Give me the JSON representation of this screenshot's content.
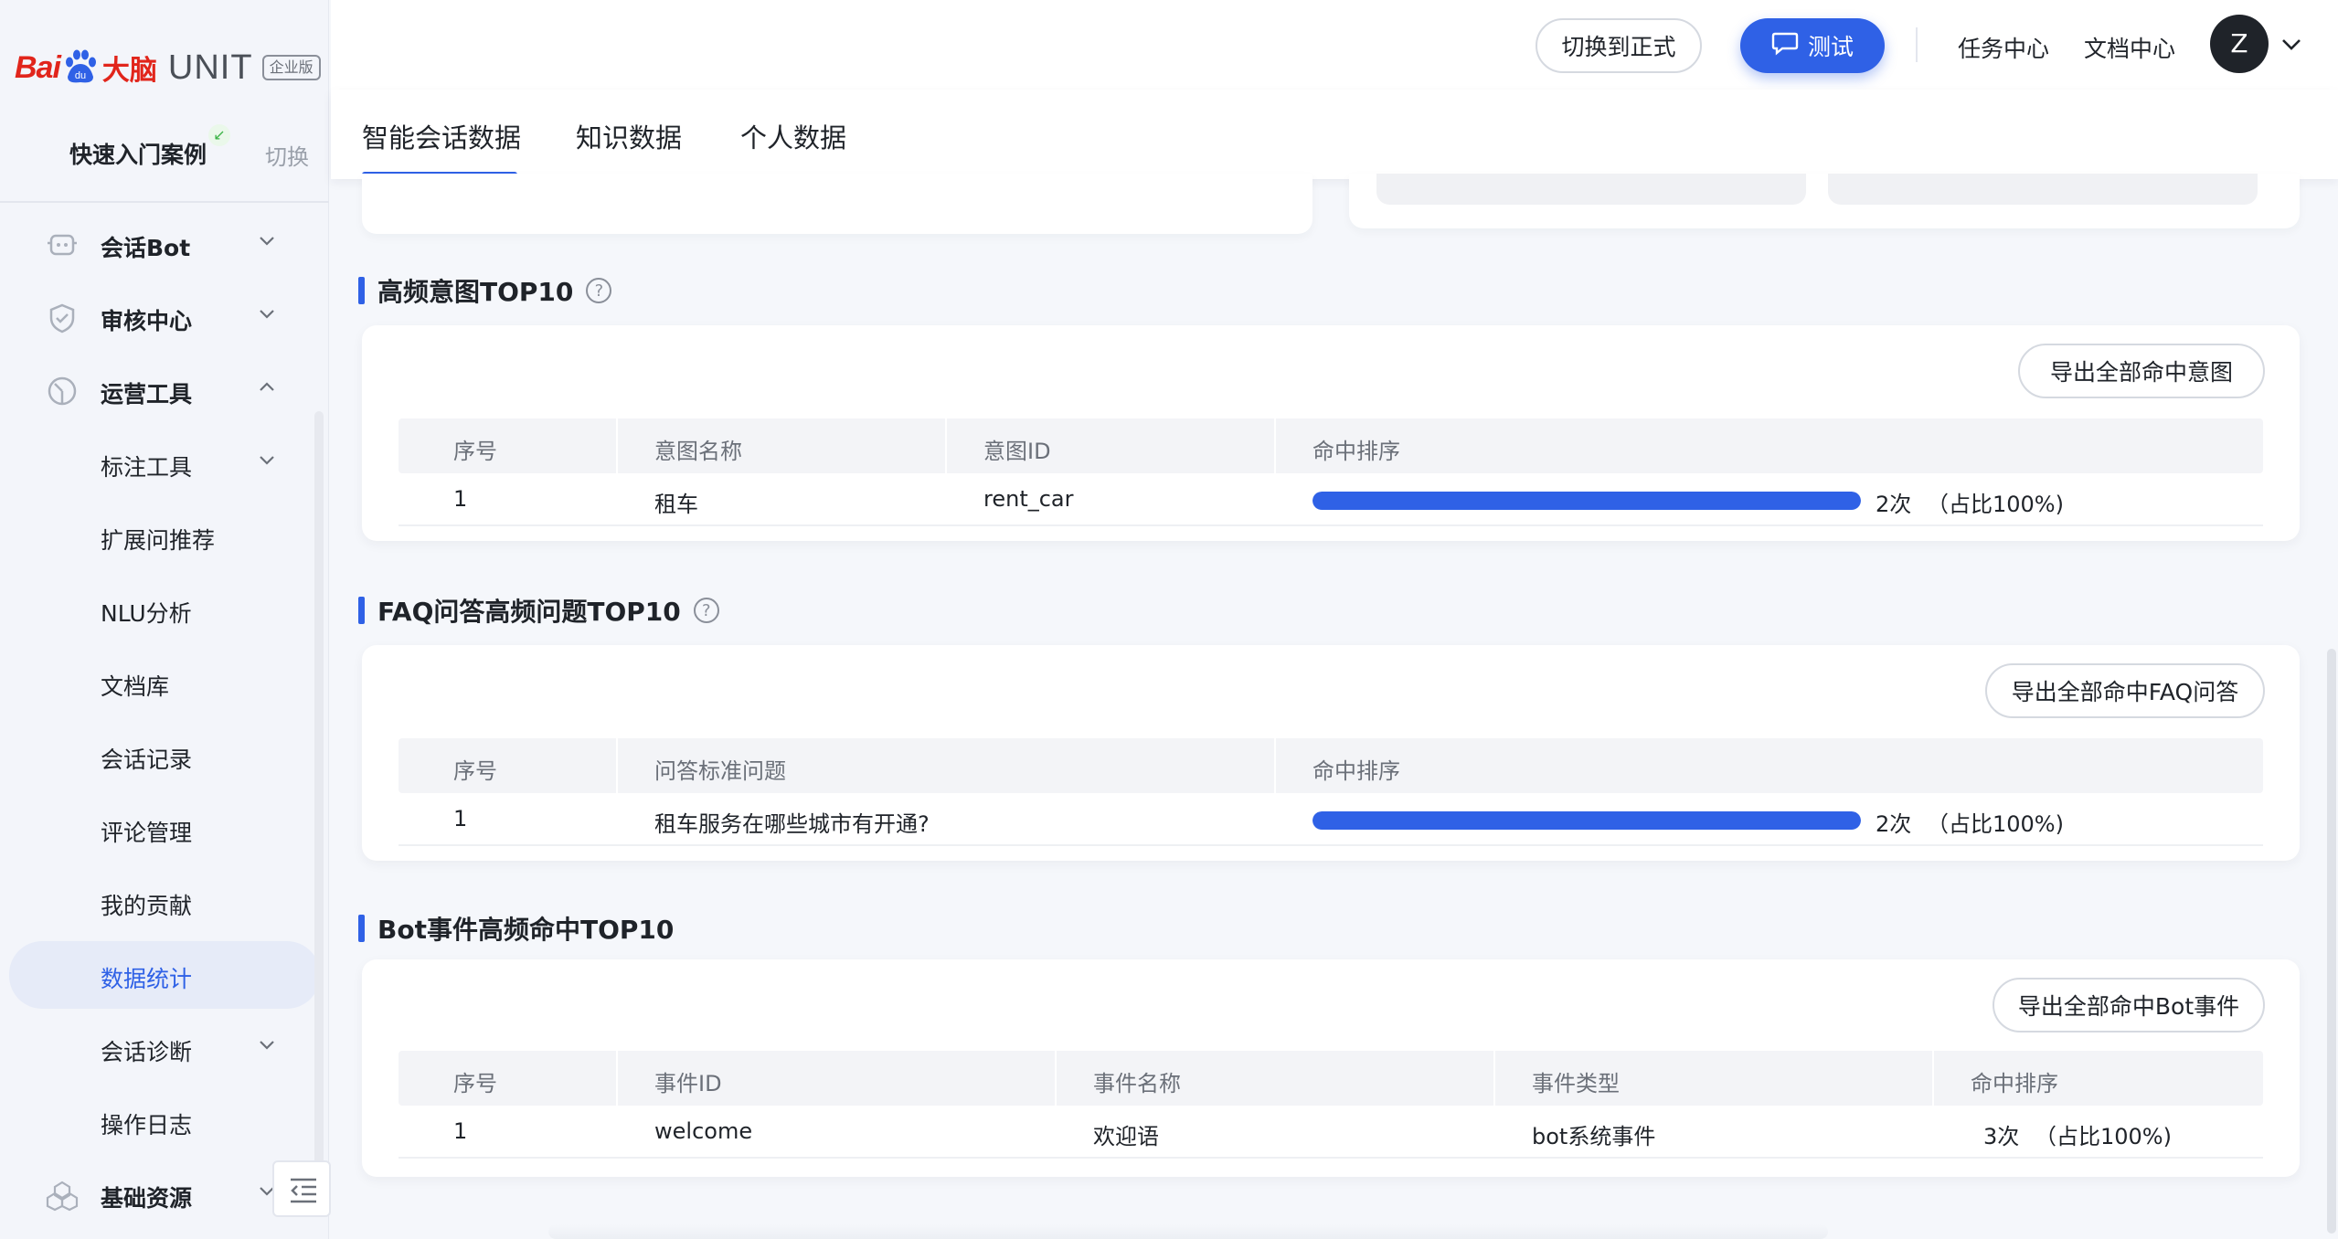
{
  "brand": {
    "bai": "Bai",
    "paw_text": "du",
    "danao": "大脑",
    "unit": "UNIT",
    "edition": "企业版"
  },
  "project": {
    "name": "快速入门案例",
    "switch": "切换"
  },
  "nav": [
    {
      "label": "会话Bot",
      "icon": "bot-icon"
    },
    {
      "label": "审核中心",
      "icon": "shield-icon"
    },
    {
      "label": "运营工具",
      "icon": "ops-icon"
    },
    {
      "label": "标注工具"
    },
    {
      "label": "扩展问推荐"
    },
    {
      "label": "NLU分析"
    },
    {
      "label": "文档库"
    },
    {
      "label": "会话记录"
    },
    {
      "label": "评论管理"
    },
    {
      "label": "我的贡献"
    },
    {
      "label": "数据统计"
    },
    {
      "label": "会话诊断"
    },
    {
      "label": "操作日志"
    },
    {
      "label": "基础资源",
      "icon": "resources-icon"
    }
  ],
  "header": {
    "switch_formal": "切换到正式",
    "test": "测试",
    "task_center": "任务中心",
    "doc_center": "文档中心",
    "avatar": "Z"
  },
  "tabs": [
    "智能会话数据",
    "知识数据",
    "个人数据"
  ],
  "intent": {
    "title": "高频意图TOP10",
    "help": "?",
    "export": "导出全部命中意图",
    "headers": [
      "序号",
      "意图名称",
      "意图ID",
      "命中排序"
    ],
    "rows": [
      {
        "no": "1",
        "name": "租车",
        "id": "rent_car",
        "hits": "2次",
        "share": "（占比100%)",
        "ratio": 1.0
      }
    ]
  },
  "faq": {
    "title": "FAQ问答高频问题TOP10",
    "help": "?",
    "export": "导出全部命中FAQ问答",
    "headers": [
      "序号",
      "问答标准问题",
      "命中排序"
    ],
    "rows": [
      {
        "no": "1",
        "question": "租车服务在哪些城市有开通?",
        "hits": "2次",
        "share": "（占比100%)",
        "ratio": 1.0
      }
    ]
  },
  "event": {
    "title": "Bot事件高频命中TOP10",
    "export": "导出全部命中Bot事件",
    "headers": [
      "序号",
      "事件ID",
      "事件名称",
      "事件类型",
      "命中排序"
    ],
    "rows": [
      {
        "no": "1",
        "id": "welcome",
        "name": "欢迎语",
        "type": "bot系统事件",
        "hits": "3次",
        "share": "（占比100%)"
      }
    ]
  },
  "colors": {
    "accent": "#2f61e6",
    "brand_red": "#e1251b"
  }
}
